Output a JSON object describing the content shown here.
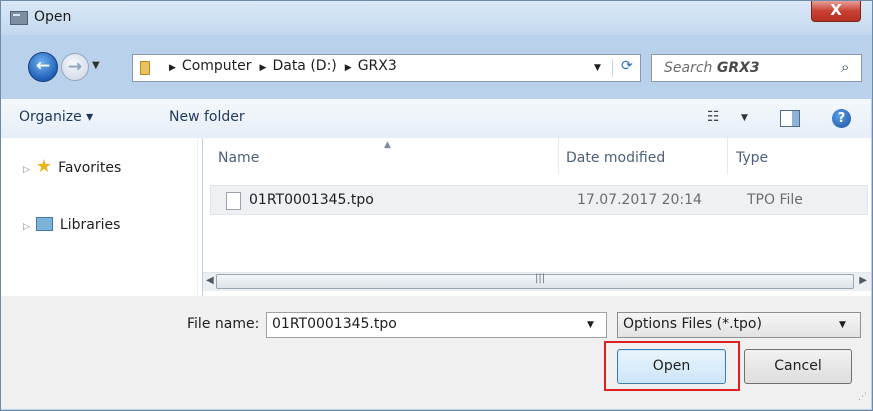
{
  "window": {
    "title": "Open",
    "close_label": "X"
  },
  "nav": {
    "back_glyph": "←",
    "forward_glyph": "→",
    "breadcrumbs": [
      "Computer",
      "Data (D:)",
      "GRX3"
    ],
    "search_prefix": "Search",
    "search_folder": "GRX3"
  },
  "toolbar": {
    "organize_label": "Organize ▾",
    "new_folder_label": "New folder"
  },
  "sidebar": {
    "items": [
      {
        "label": "Favorites",
        "icon": "star-icon"
      },
      {
        "label": "Libraries",
        "icon": "libraries-icon"
      }
    ]
  },
  "file_list": {
    "columns": [
      "Name",
      "Date modified",
      "Type"
    ],
    "rows": [
      {
        "name": "01RT0001345.tpo",
        "date_modified": "17.07.2017 20:14",
        "type": "TPO File"
      }
    ]
  },
  "footer": {
    "file_name_label": "File name:",
    "file_name_value": "01RT0001345.tpo",
    "file_type_value": "Options Files (*.tpo)",
    "open_label": "Open",
    "cancel_label": "Cancel"
  },
  "colors": {
    "highlight": "#e02020",
    "close": "#c94133"
  }
}
